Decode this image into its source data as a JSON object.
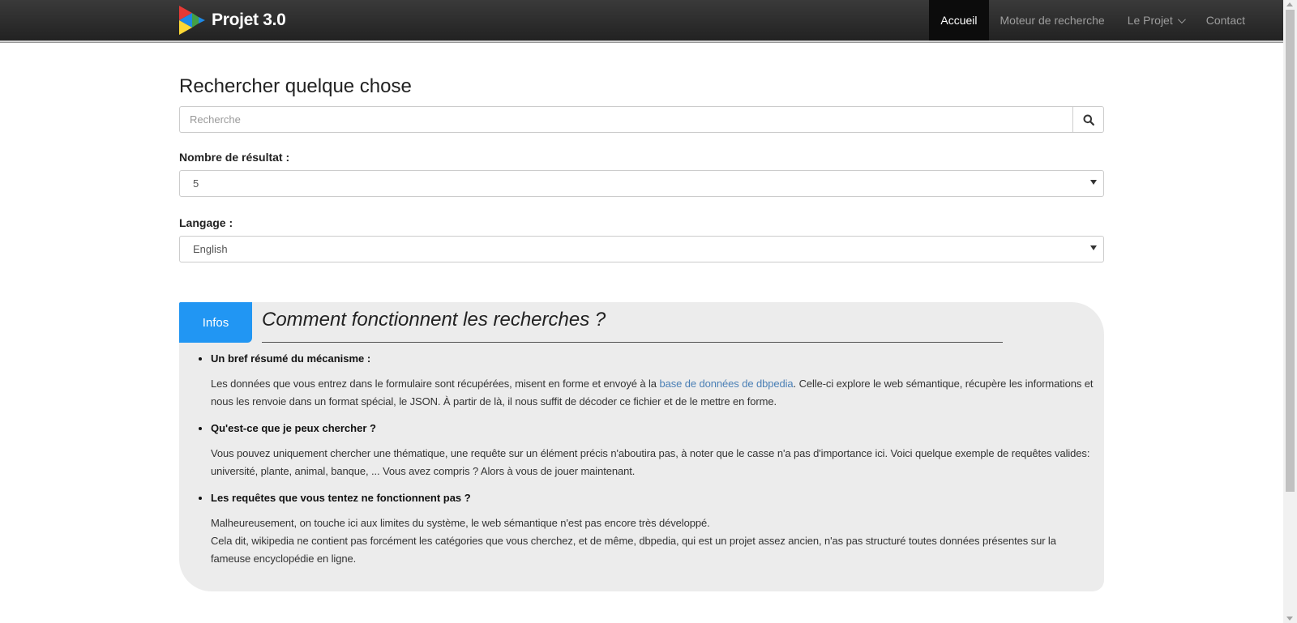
{
  "navbar": {
    "brand": "Projet 3.0",
    "items": [
      {
        "label": "Accueil",
        "active": true
      },
      {
        "label": "Moteur de recherche",
        "active": false
      },
      {
        "label": "Le Projet",
        "active": false,
        "dropdown": true
      },
      {
        "label": "Contact",
        "active": false
      }
    ]
  },
  "search": {
    "title": "Rechercher quelque chose",
    "placeholder": "Recherche",
    "button_icon": "search-icon"
  },
  "results_count": {
    "label": "Nombre de résultat :",
    "selected": "5"
  },
  "language": {
    "label": "Langage :",
    "selected": "English"
  },
  "info": {
    "tab_label": "Infos",
    "title": "Comment fonctionnent les recherches ?",
    "items": [
      {
        "title": "Un bref résumé du mécanisme :",
        "text_before": "Les données que vous entrez dans le formulaire sont récupérées, misent en forme et envoyé à la ",
        "link": "base de données de dbpedia",
        "text_after": ". Celle-ci explore le web sémantique, récupère les informations et nous les renvoie dans un format spécial, le JSON. À partir de là, il nous suffit de décoder ce fichier et de le mettre en forme."
      },
      {
        "title": "Qu'est-ce que je peux chercher ?",
        "text": "Vous pouvez uniquement chercher une thématique, une requête sur un élément précis n'aboutira pas, à noter que le casse n'a pas d'importance ici. Voici quelque exemple de requêtes valides: université, plante, animal, banque, ... Vous avez compris ? Alors à vous de jouer maintenant."
      },
      {
        "title": "Les requêtes que vous tentez ne fonctionnent pas ?",
        "text_line1": "Malheureusement, on touche ici aux limites du système, le web sémantique n'est pas encore très développé.",
        "text_line2": "Cela dit, wikipedia ne contient pas forcément les catégories que vous cherchez, et de même, dbpedia, qui est un projet assez ancien, n'as pas structuré toutes données présentes sur la fameuse encyclopédie en ligne."
      }
    ]
  },
  "colors": {
    "navbar_bg": "#222222",
    "accent": "#2196f3",
    "link": "#4a7fb5",
    "panel_bg": "#ececec"
  }
}
